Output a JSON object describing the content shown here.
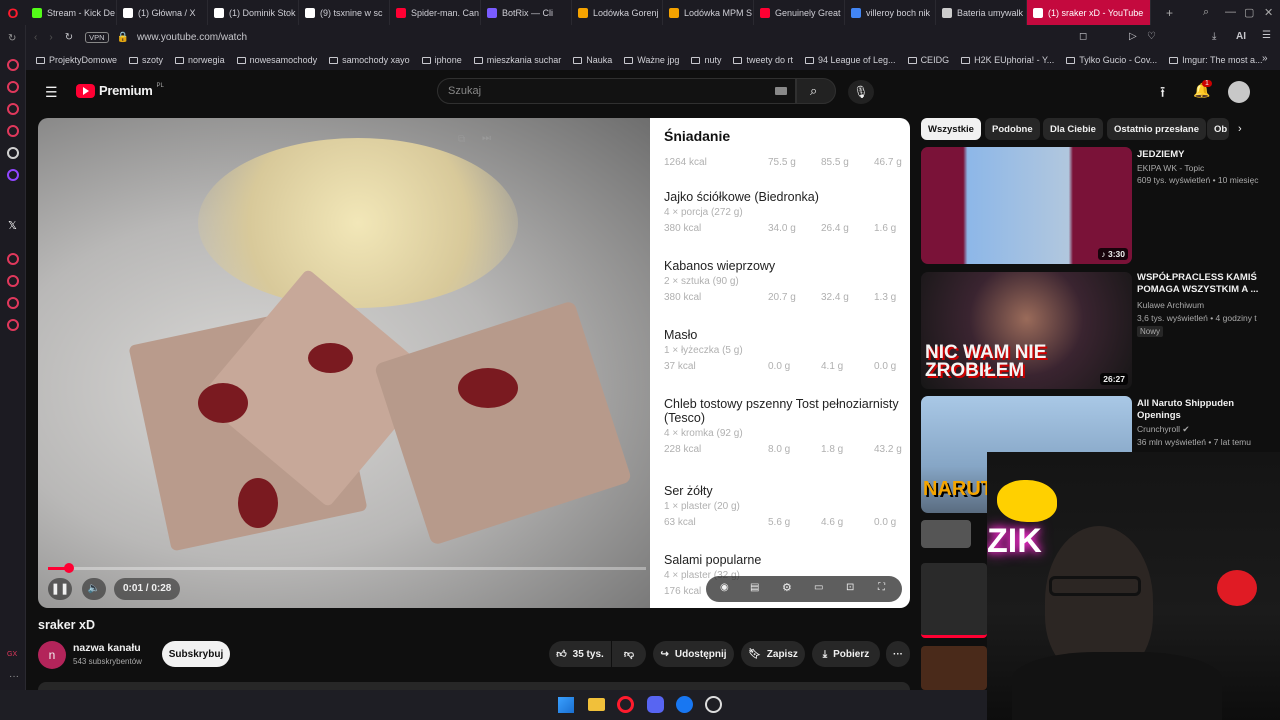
{
  "tabs": [
    {
      "label": "Stream - Kick De",
      "color": "#53fc18"
    },
    {
      "label": "(1) Główna / X",
      "color": "#ffffff"
    },
    {
      "label": "(1) Dominik Stok",
      "color": "#ffffff"
    },
    {
      "label": "(9) tsxnine w sc",
      "color": "#ffffff"
    },
    {
      "label": "Spider-man. Can",
      "color": "#ff0033"
    },
    {
      "label": "BotRix — Cli",
      "color": "#7a5cff"
    },
    {
      "label": "Lodówka Gorenj",
      "color": "#f5a300"
    },
    {
      "label": "Lodówka MPM S",
      "color": "#f5a300"
    },
    {
      "label": "Genuinely Great",
      "color": "#ff0033"
    },
    {
      "label": "villeroy boch nik",
      "color": "#4285f4"
    },
    {
      "label": "Bateria umywalk",
      "color": "#cccccc"
    },
    {
      "label": "(1) sraker xD - YouTube",
      "color": "#ffffff"
    }
  ],
  "address": {
    "vpn": "VPN",
    "url": "www.youtube.com/watch",
    "ai_label": "AI"
  },
  "bookmarks": [
    "ProjektyDomowe",
    "szoty",
    "norwegia",
    "nowesamochody",
    "samochody xayo",
    "iphone",
    "mieszkania suchar",
    "Nauka",
    "Ważne jpg",
    "nuty",
    "tweety do rt",
    "94 League of Leg...",
    "CEIDG",
    "H2K EUphoria! - Y...",
    "Tylko Gucio - Cov...",
    "Imgur: The most a..."
  ],
  "header": {
    "brand": "Premium",
    "brand_sup": "PL",
    "search_placeholder": "Szukaj",
    "notif_count": "1"
  },
  "nutrition": {
    "header": {
      "title": "Śniadanie",
      "kcal": "1264 kcal",
      "c": "75.5 g",
      "f": "85.5 g",
      "p": "46.7 g"
    },
    "items": [
      {
        "name": "Jajko ściółkowe (Biedronka)",
        "portion": "4 × porcja (272 g)",
        "kcal": "380 kcal",
        "c": "34.0 g",
        "f": "26.4 g",
        "p": "1.6 g"
      },
      {
        "name": "Kabanos wieprzowy",
        "portion": "2 × sztuka (90 g)",
        "kcal": "380 kcal",
        "c": "20.7 g",
        "f": "32.4 g",
        "p": "1.3 g"
      },
      {
        "name": "Masło",
        "portion": "1 × łyżeczka (5 g)",
        "kcal": "37 kcal",
        "c": "0.0 g",
        "f": "4.1 g",
        "p": "0.0 g"
      },
      {
        "name": "Chleb tostowy pszenny Tost pełnoziarnisty (Tesco)",
        "portion": "4 × kromka (92 g)",
        "kcal": "228 kcal",
        "c": "8.0 g",
        "f": "1.8 g",
        "p": "43.2 g"
      },
      {
        "name": "Ser żółty",
        "portion": "1 × plaster (20 g)",
        "kcal": "63 kcal",
        "c": "5.6 g",
        "f": "4.6 g",
        "p": "0.0 g"
      },
      {
        "name": "Salami popularne",
        "portion": "4 × plaster (32 g)",
        "kcal": "176 kcal",
        "c": "",
        "f": "",
        "p": ""
      }
    ]
  },
  "player": {
    "time": "0:01 / 0:28",
    "progress": 0.035
  },
  "video": {
    "title": "sraker xD",
    "channel": "nazwa kanału",
    "channel_initial": "n",
    "subs": "543 subskrybentów",
    "subscribe": "Subskrybuj",
    "likes": "35 tys.",
    "share": "Udostępnij",
    "save": "Zapisz",
    "download": "Pobierz"
  },
  "chips": [
    "Wszystkie",
    "Podobne",
    "Dla Ciebie",
    "Ostatnio przesłane",
    "Ob"
  ],
  "recs": [
    {
      "title": "JEDZIEMY",
      "channel": "EKIPA WK - Topic",
      "meta": "609 tys. wyświetleń • 10 miesięc",
      "duration": "♪ 3:30",
      "badge": ""
    },
    {
      "title": "WSPÓŁPRACLESS KAMIŚ POMAGA WSZYSTKIM A ...",
      "channel": "Kulawe Archiwum",
      "meta": "3,6 tys. wyświetleń • 4 godziny t",
      "duration": "26:27",
      "badge": "Nowy",
      "thumb_text": "NIC WAM NIE ZROBIŁEM"
    },
    {
      "title": "All Naruto Shippuden Openings",
      "channel": "Crunchyroll",
      "meta": "36 mln wyświetleń • 7 lat temu",
      "duration": "",
      "badge": "",
      "thumb_text": "NARUTO"
    }
  ],
  "webcam": {
    "overlay_text": "ZIK"
  }
}
